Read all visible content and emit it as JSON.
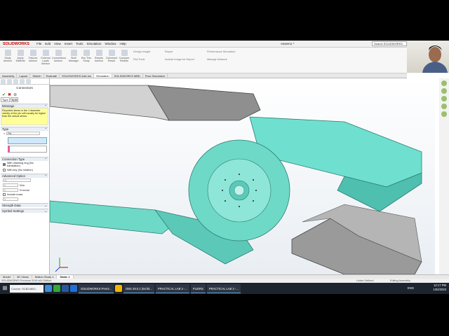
{
  "app": {
    "logo": "SOLIDWORKS",
    "menu": [
      "File",
      "Edit",
      "View",
      "Insert",
      "Tools",
      "Simulation",
      "Window",
      "Help"
    ],
    "doc_title": "Assem1 *",
    "search_placeholder": "Search SOLIDWORKS Help"
  },
  "ribbon": {
    "buttons": [
      "Study Advisor",
      "Apply Material",
      "Fixtures Advisor",
      "External Loads Advisor",
      "Connections Advisor",
      "Shell Manager",
      "Run This Study",
      "Results Advisor",
      "Deformed Result",
      "Compare Results"
    ],
    "small": [
      "Design Insight",
      "Plot Tools",
      "Report",
      "Include Image for Report",
      "Performance Simulation",
      "Manage Network"
    ]
  },
  "tabs": [
    "Assembly",
    "Layout",
    "Sketch",
    "Evaluate",
    "SOLIDWORKS Add-Ins",
    "Simulation",
    "SOLIDWORKS MBD",
    "Flow Simulation"
  ],
  "active_tab": "Simulation",
  "panel": {
    "title": "Connectors",
    "tabs": [
      "Type",
      "Split"
    ],
    "message_head": "Message",
    "message": "Reported stress in the 1 diameter vicinity of the pin will usually be higher than the actual stress.",
    "type_head": "Type",
    "type_value": "Pin",
    "conn_head": "Connection Type",
    "opt1": "With retaining ring (No translation)",
    "opt2": "With key (No rotation)",
    "adv_head": "Advanced Option",
    "f1": "0",
    "f2": "0",
    "unit1": "N/m",
    "unit2": "N·m/rad",
    "include_mass": "Include mass",
    "f3": "0",
    "strength": "Strength Data",
    "symbol": "Symbol Settings"
  },
  "bottom_tabs": [
    "Model",
    "3D Views",
    "Motion Study 1",
    "Static 1"
  ],
  "active_bottom": "Static 1",
  "status": {
    "left": "SOLIDWORKS Premium 2016 x64 Edition",
    "mid": "Under Defined",
    "right": "Editing Assembly"
  },
  "taskbar": {
    "search": "Course: SCB24803 -",
    "apps": [
      "SOLIDWORKS Premi...",
      "OBS 29.0.2 (64 bit...",
      "PRACTICAL LAB 3 -...",
      "PLIERS",
      "PRACTICAL LAB 3 -..."
    ],
    "lang": "ENG",
    "time": "12:17 PM",
    "date": "13/4/2023"
  },
  "colors": {
    "part_teal": "#5fd6c4",
    "part_grey": "#9a9a9a",
    "handle_dark": "#777777",
    "accent": "#c00000"
  }
}
